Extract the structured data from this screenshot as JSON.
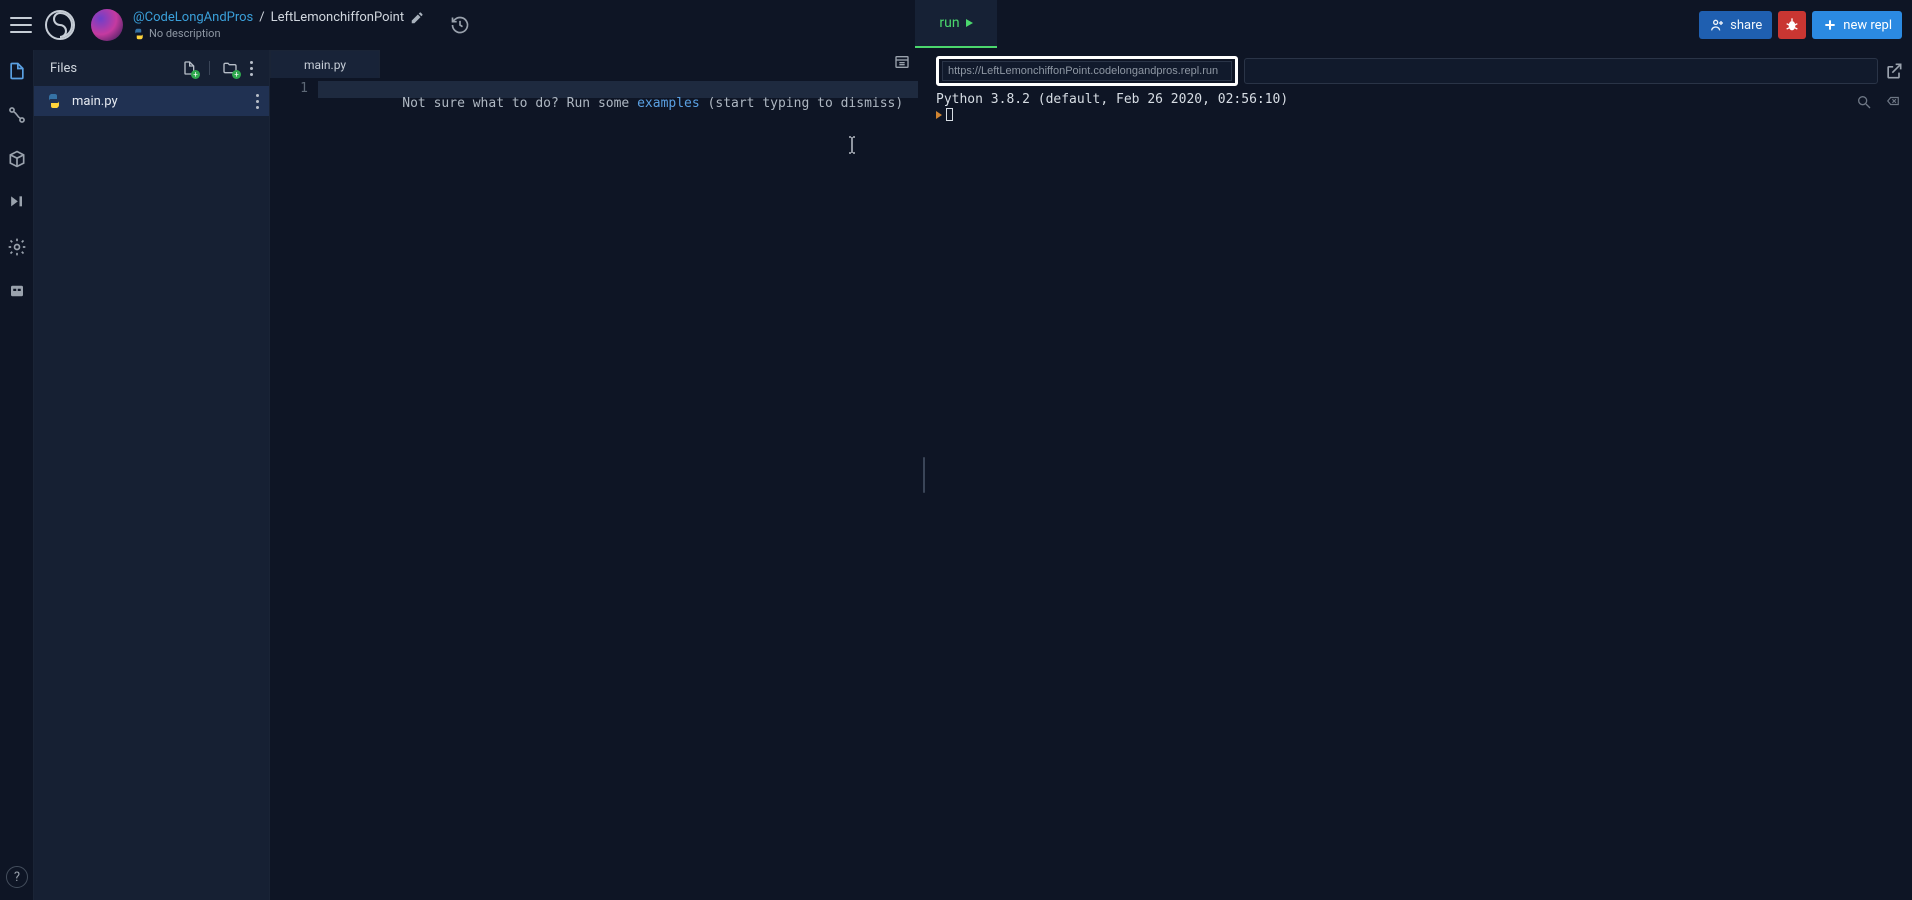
{
  "header": {
    "user": "@CodeLongAndPros",
    "slash": "/",
    "repl_name": "LeftLemonchiffonPoint",
    "description": "No description",
    "run_label": "run",
    "share_label": "share",
    "new_repl_label": "new repl"
  },
  "files_panel": {
    "title": "Files",
    "items": [
      {
        "name": "main.py",
        "type": "python"
      }
    ]
  },
  "editor": {
    "tab_label": "main.py",
    "line_number": "1",
    "placeholder_before": "Not sure what to do? Run some ",
    "placeholder_link": "examples",
    "placeholder_after": " (start typing to dismiss)"
  },
  "console": {
    "url": "https://LeftLemonchiffonPoint.codelongandpros.repl.run",
    "version_line": "Python 3.8.2 (default, Feb 26 2020, 02:56:10)"
  },
  "help_label": "?"
}
